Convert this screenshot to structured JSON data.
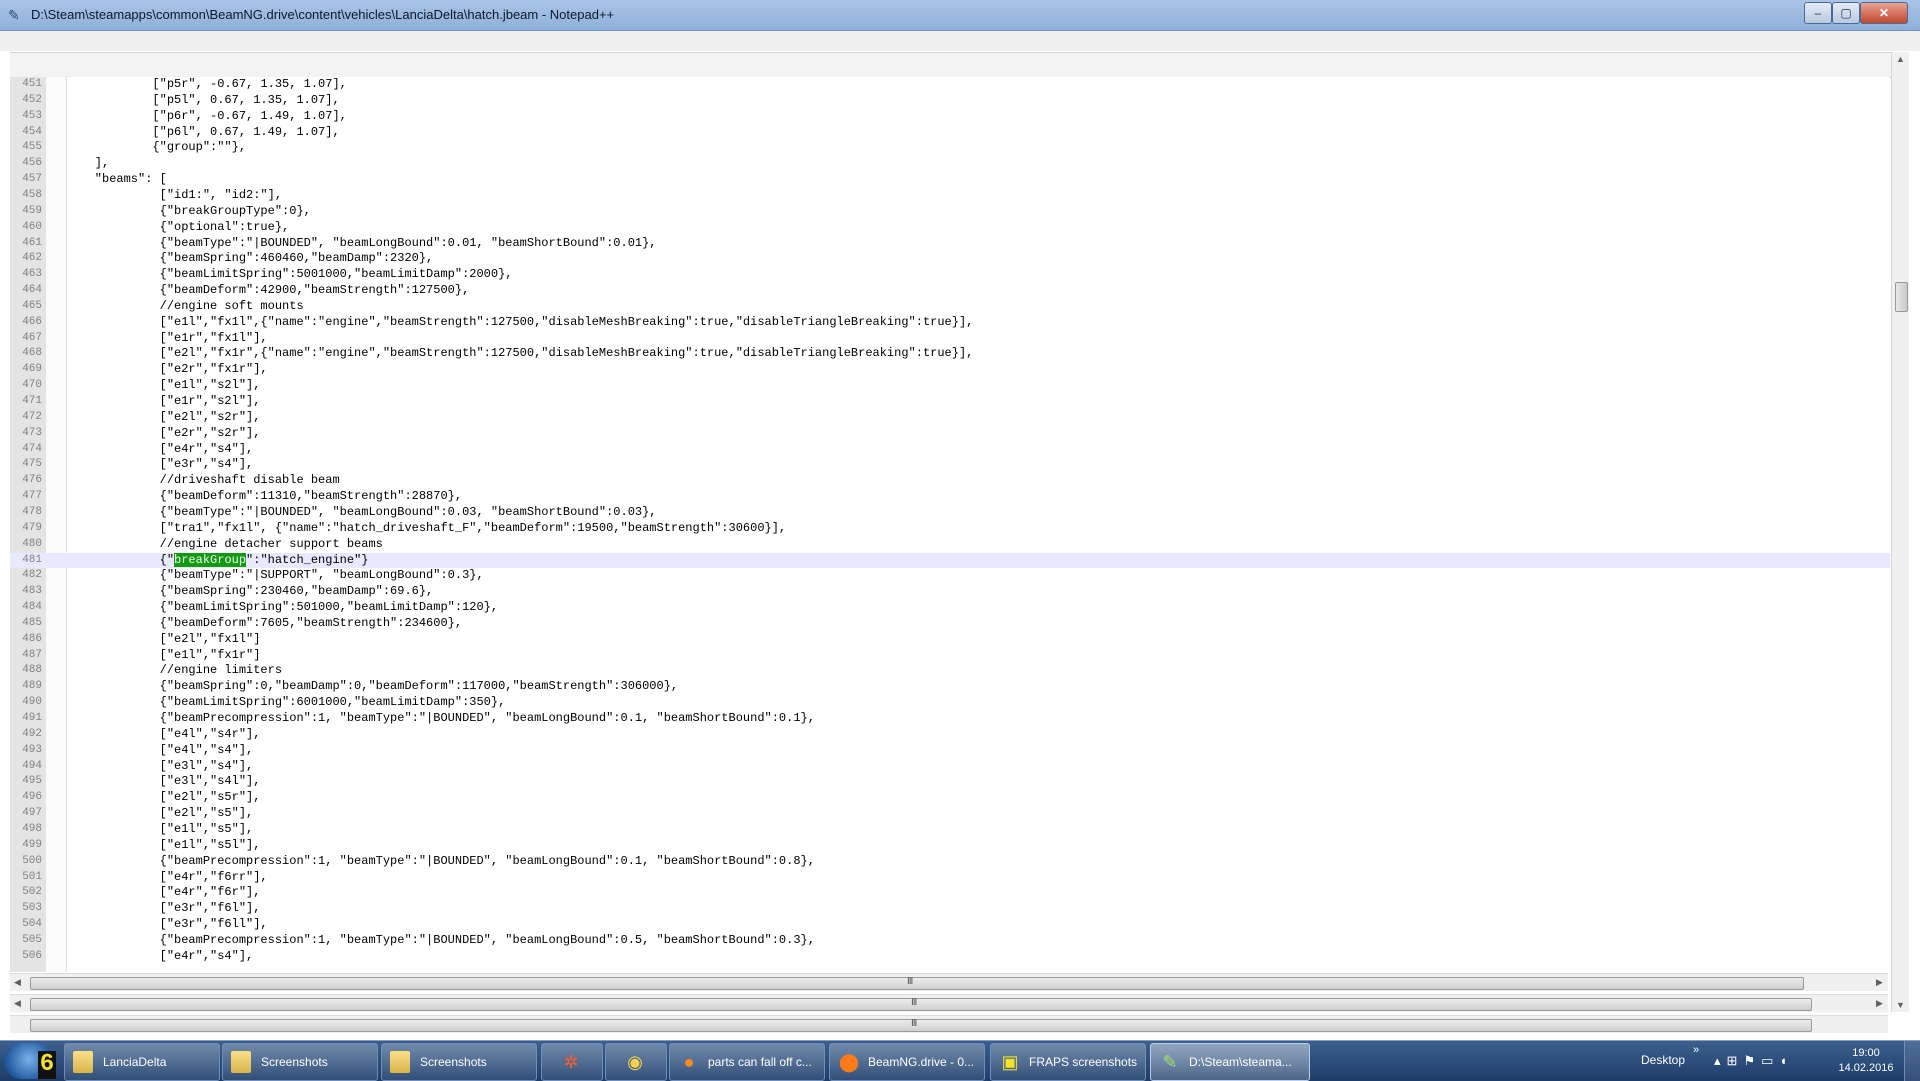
{
  "window": {
    "title": "D:\\Steam\\steamapps\\common\\BeamNG.drive\\content\\vehicles\\LanciaDelta\\hatch.jbeam - Notepad++",
    "buttons": {
      "minimize": "–",
      "maximize": "▢",
      "close": "✕"
    }
  },
  "editor": {
    "current_line": 481,
    "highlighted_word": "breakGroup",
    "lines": [
      {
        "n": "451",
        "text": "            [\"p5r\", -0.67, 1.35, 1.07],"
      },
      {
        "n": "452",
        "text": "            [\"p5l\", 0.67, 1.35, 1.07],"
      },
      {
        "n": "453",
        "text": "            [\"p6r\", -0.67, 1.49, 1.07],"
      },
      {
        "n": "454",
        "text": "            [\"p6l\", 0.67, 1.49, 1.07],"
      },
      {
        "n": "455",
        "text": "            {\"group\":\"\"},"
      },
      {
        "n": "456",
        "text": "    ],"
      },
      {
        "n": "457",
        "text": "    \"beams\": ["
      },
      {
        "n": "458",
        "text": "             [\"id1:\", \"id2:\"],"
      },
      {
        "n": "459",
        "text": "             {\"breakGroupType\":0},"
      },
      {
        "n": "460",
        "text": "             {\"optional\":true},"
      },
      {
        "n": "461",
        "text": "             {\"beamType\":\"|BOUNDED\", \"beamLongBound\":0.01, \"beamShortBound\":0.01},"
      },
      {
        "n": "462",
        "text": "             {\"beamSpring\":460460,\"beamDamp\":2320},"
      },
      {
        "n": "463",
        "text": "             {\"beamLimitSpring\":5001000,\"beamLimitDamp\":2000},"
      },
      {
        "n": "464",
        "text": "             {\"beamDeform\":42900,\"beamStrength\":127500},"
      },
      {
        "n": "465",
        "text": "             //engine soft mounts"
      },
      {
        "n": "466",
        "text": "             [\"e1l\",\"fx1l\",{\"name\":\"engine\",\"beamStrength\":127500,\"disableMeshBreaking\":true,\"disableTriangleBreaking\":true}],"
      },
      {
        "n": "467",
        "text": "             [\"e1r\",\"fx1l\"],"
      },
      {
        "n": "468",
        "text": "             [\"e2l\",\"fx1r\",{\"name\":\"engine\",\"beamStrength\":127500,\"disableMeshBreaking\":true,\"disableTriangleBreaking\":true}],"
      },
      {
        "n": "469",
        "text": "             [\"e2r\",\"fx1r\"],"
      },
      {
        "n": "470",
        "text": "             [\"e1l\",\"s2l\"],"
      },
      {
        "n": "471",
        "text": "             [\"e1r\",\"s2l\"],"
      },
      {
        "n": "472",
        "text": "             [\"e2l\",\"s2r\"],"
      },
      {
        "n": "473",
        "text": "             [\"e2r\",\"s2r\"],"
      },
      {
        "n": "474",
        "text": "             [\"e4r\",\"s4\"],"
      },
      {
        "n": "475",
        "text": "             [\"e3r\",\"s4\"],"
      },
      {
        "n": "476",
        "text": "             //driveshaft disable beam"
      },
      {
        "n": "477",
        "text": "             {\"beamDeform\":11310,\"beamStrength\":28870},"
      },
      {
        "n": "478",
        "text": "             {\"beamType\":\"|BOUNDED\", \"beamLongBound\":0.03, \"beamShortBound\":0.03},"
      },
      {
        "n": "479",
        "text": "             [\"tra1\",\"fx1l\", {\"name\":\"hatch_driveshaft_F\",\"beamDeform\":19500,\"beamStrength\":30600}],"
      },
      {
        "n": "480",
        "text": "             //engine detacher support beams"
      },
      {
        "n": "481",
        "text_before": "             {\"",
        "text_hl": "breakGroup",
        "text_after": "\":\"hatch_engine\"}"
      },
      {
        "n": "482",
        "text": "             {\"beamType\":\"|SUPPORT\", \"beamLongBound\":0.3},"
      },
      {
        "n": "483",
        "text": "             {\"beamSpring\":230460,\"beamDamp\":69.6},"
      },
      {
        "n": "484",
        "text": "             {\"beamLimitSpring\":501000,\"beamLimitDamp\":120},"
      },
      {
        "n": "485",
        "text": "             {\"beamDeform\":7605,\"beamStrength\":234600},"
      },
      {
        "n": "486",
        "text": "             [\"e2l\",\"fx1l\"]"
      },
      {
        "n": "487",
        "text": "             [\"e1l\",\"fx1r\"]"
      },
      {
        "n": "488",
        "text": "             //engine limiters"
      },
      {
        "n": "489",
        "text": "             {\"beamSpring\":0,\"beamDamp\":0,\"beamDeform\":117000,\"beamStrength\":306000},"
      },
      {
        "n": "490",
        "text": "             {\"beamLimitSpring\":6001000,\"beamLimitDamp\":350},"
      },
      {
        "n": "491",
        "text": "             {\"beamPrecompression\":1, \"beamType\":\"|BOUNDED\", \"beamLongBound\":0.1, \"beamShortBound\":0.1},"
      },
      {
        "n": "492",
        "text": "             [\"e4l\",\"s4r\"],"
      },
      {
        "n": "493",
        "text": "             [\"e4l\",\"s4\"],"
      },
      {
        "n": "494",
        "text": "             [\"e3l\",\"s4\"],"
      },
      {
        "n": "495",
        "text": "             [\"e3l\",\"s4l\"],"
      },
      {
        "n": "496",
        "text": "             [\"e2l\",\"s5r\"],"
      },
      {
        "n": "497",
        "text": "             [\"e2l\",\"s5\"],"
      },
      {
        "n": "498",
        "text": "             [\"e1l\",\"s5\"],"
      },
      {
        "n": "499",
        "text": "             [\"e1l\",\"s5l\"],"
      },
      {
        "n": "500",
        "text": "             {\"beamPrecompression\":1, \"beamType\":\"|BOUNDED\", \"beamLongBound\":0.1, \"beamShortBound\":0.8},"
      },
      {
        "n": "501",
        "text": "             [\"e4r\",\"f6rr\"],"
      },
      {
        "n": "502",
        "text": "             [\"e4r\",\"f6r\"],"
      },
      {
        "n": "503",
        "text": "             [\"e3r\",\"f6l\"],"
      },
      {
        "n": "504",
        "text": "             [\"e3r\",\"f6ll\"],"
      },
      {
        "n": "505",
        "text": "             {\"beamPrecompression\":1, \"beamType\":\"|BOUNDED\", \"beamLongBound\":0.5, \"beamShortBound\":0.3},"
      },
      {
        "n": "506",
        "text": "             [\"e4r\",\"s4\"],"
      }
    ]
  },
  "scrollbar_grip": "III",
  "taskbar": {
    "fraps_fps": "6",
    "items": [
      {
        "label": "LanciaDelta",
        "icon": "folder-icon"
      },
      {
        "label": "Screenshots",
        "icon": "folder-icon"
      },
      {
        "label": "Screenshots",
        "icon": "folder-icon"
      },
      {
        "label": "",
        "icon": "fraps-icon"
      },
      {
        "label": "",
        "icon": "chrome-icon"
      },
      {
        "label": "parts can fall off c...",
        "icon": "firefox-icon"
      },
      {
        "label": "BeamNG.drive - 0...",
        "icon": "beamng-icon"
      },
      {
        "label": "FRAPS screenshots",
        "icon": "fraps-folder-icon"
      },
      {
        "label": "D:\\Steam\\steama...",
        "icon": "notepadpp-icon"
      }
    ],
    "desktop_label": "Desktop",
    "tray_chevron": "»",
    "clock_time": "19:00",
    "clock_date": "14.02.2016"
  }
}
